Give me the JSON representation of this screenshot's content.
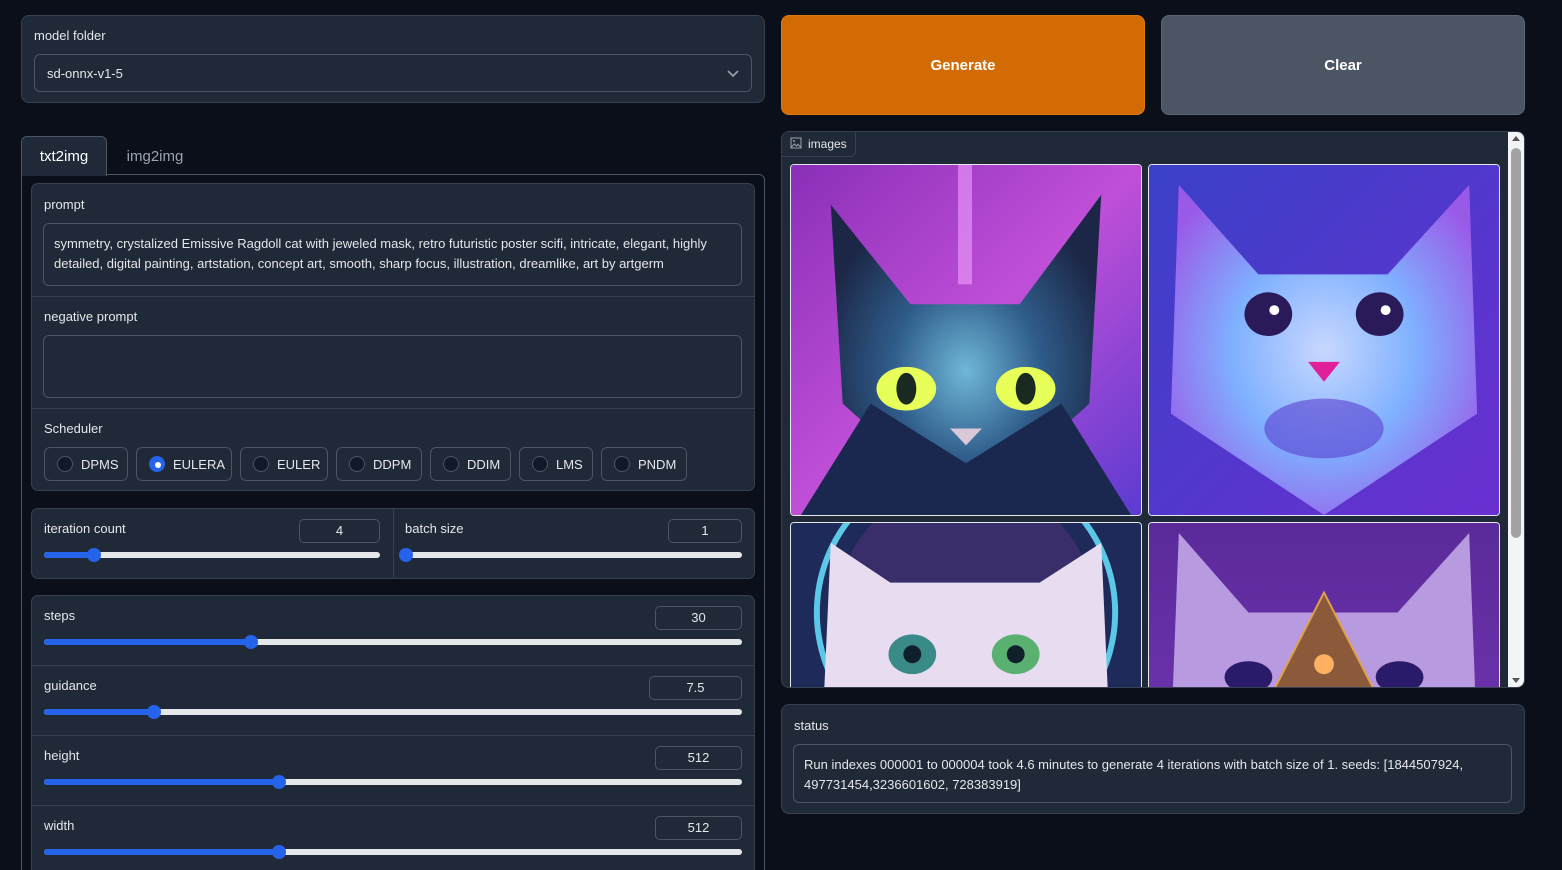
{
  "model_folder": {
    "label": "model folder",
    "value": "sd-onnx-v1-5"
  },
  "actions": {
    "generate": "Generate",
    "clear": "Clear"
  },
  "tabs": [
    {
      "label": "txt2img",
      "active": true
    },
    {
      "label": "img2img",
      "active": false
    }
  ],
  "prompt": {
    "label": "prompt",
    "value": "symmetry, crystalized Emissive Ragdoll cat with jeweled mask, retro futuristic poster scifi, intricate, elegant, highly detailed, digital painting, artstation, concept art, smooth, sharp focus, illustration, dreamlike, art by artgerm"
  },
  "negative_prompt": {
    "label": "negative prompt",
    "value": ""
  },
  "scheduler": {
    "label": "Scheduler",
    "options": [
      "DPMS",
      "EULERA",
      "EULER",
      "DDPM",
      "DDIM",
      "LMS",
      "PNDM"
    ],
    "selected": "EULERA"
  },
  "iteration_count": {
    "label": "iteration count",
    "value": "4",
    "fraction": 0.15
  },
  "batch_size": {
    "label": "batch size",
    "value": "1",
    "fraction": 0.0
  },
  "steps": {
    "label": "steps",
    "value": "30",
    "fraction": 0.296
  },
  "guidance": {
    "label": "guidance",
    "value": "7.5",
    "fraction": 0.157
  },
  "height": {
    "label": "height",
    "value": "512",
    "fraction": 0.336
  },
  "width": {
    "label": "width",
    "value": "512",
    "fraction": 0.336
  },
  "gallery": {
    "label": "images",
    "images": [
      {
        "name": "dark-blue-cat-yellow-eyes"
      },
      {
        "name": "blue-fluffy-cat-purple-eyes"
      },
      {
        "name": "white-cat-green-eyes"
      },
      {
        "name": "purple-cat-jeweled-mask"
      }
    ]
  },
  "status": {
    "label": "status",
    "value": "Run indexes 000001 to 000004 took 4.6 minutes to generate 4 iterations with batch size of 1. seeds: [1844507924, 497731454,3236601602, 728383919]"
  },
  "colors": {
    "accent": "#2563eb",
    "generate": "#d36b04",
    "clear": "#4b5563",
    "background": "#0b0f19",
    "panel": "#1f2937"
  }
}
